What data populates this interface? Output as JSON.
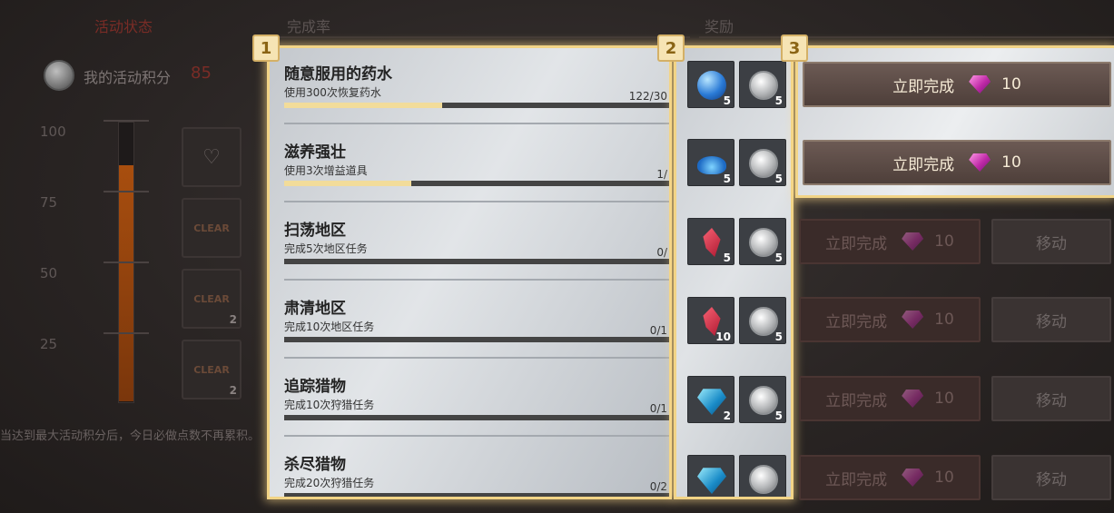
{
  "headers": {
    "activity_status": "活动状态",
    "completion_rate": "完成率",
    "reward": "奖励"
  },
  "score": {
    "label": "我的活动积分",
    "value": "85"
  },
  "ticks": [
    "100",
    "75",
    "50",
    "25"
  ],
  "score_fill_fraction": 0.85,
  "left_rewards": [
    {
      "text": "",
      "count": ""
    },
    {
      "text": "CLEAR",
      "count": ""
    },
    {
      "text": "CLEAR",
      "count": "2"
    },
    {
      "text": "CLEAR",
      "count": "2"
    }
  ],
  "note": "当达到最大活动积分后，今日必做点数不再累积。",
  "badges": [
    "1",
    "2",
    "3"
  ],
  "tasks": [
    {
      "title": "随意服用的药水",
      "desc": "使用300次恢复药水",
      "progress": "122/30",
      "fraction": 0.41,
      "rewards": [
        {
          "icon": "potion-orb-icon",
          "count": "5"
        },
        {
          "icon": "silver-coin-icon",
          "count": "5"
        }
      ]
    },
    {
      "title": "滋养强壮",
      "desc": "使用3次增益道具",
      "progress": "1/",
      "fraction": 0.33,
      "rewards": [
        {
          "icon": "blue-crystal-dust-icon",
          "count": "5"
        },
        {
          "icon": "silver-coin-icon",
          "count": "5"
        }
      ]
    },
    {
      "title": "扫荡地区",
      "desc": "完成5次地区任务",
      "progress": "0/",
      "fraction": 0,
      "rewards": [
        {
          "icon": "red-crystal-icon",
          "count": "5"
        },
        {
          "icon": "silver-coin-icon",
          "count": "5"
        }
      ]
    },
    {
      "title": "肃清地区",
      "desc": "完成10次地区任务",
      "progress": "0/1",
      "fraction": 0,
      "rewards": [
        {
          "icon": "red-crystal-icon",
          "count": "10"
        },
        {
          "icon": "silver-coin-icon",
          "count": "5"
        }
      ]
    },
    {
      "title": "追踪猎物",
      "desc": "完成10次狩猎任务",
      "progress": "0/1",
      "fraction": 0,
      "rewards": [
        {
          "icon": "blue-gem-icon",
          "count": "2"
        },
        {
          "icon": "silver-coin-icon",
          "count": "5"
        }
      ]
    },
    {
      "title": "杀尽猎物",
      "desc": "完成20次狩猎任务",
      "progress": "0/2",
      "fraction": 0,
      "rewards": [
        {
          "icon": "blue-gem-icon",
          "count": ""
        },
        {
          "icon": "silver-coin-icon",
          "count": ""
        }
      ]
    }
  ],
  "actions": [
    {
      "complete_label": "立即完成",
      "cost": "10",
      "move_label": ""
    },
    {
      "complete_label": "立即完成",
      "cost": "10",
      "move_label": ""
    },
    {
      "complete_label": "立即完成",
      "cost": "10",
      "move_label": "移动"
    },
    {
      "complete_label": "立即完成",
      "cost": "10",
      "move_label": "移动"
    },
    {
      "complete_label": "立即完成",
      "cost": "10",
      "move_label": "移动"
    },
    {
      "complete_label": "立即完成",
      "cost": "10",
      "move_label": "移动"
    }
  ]
}
